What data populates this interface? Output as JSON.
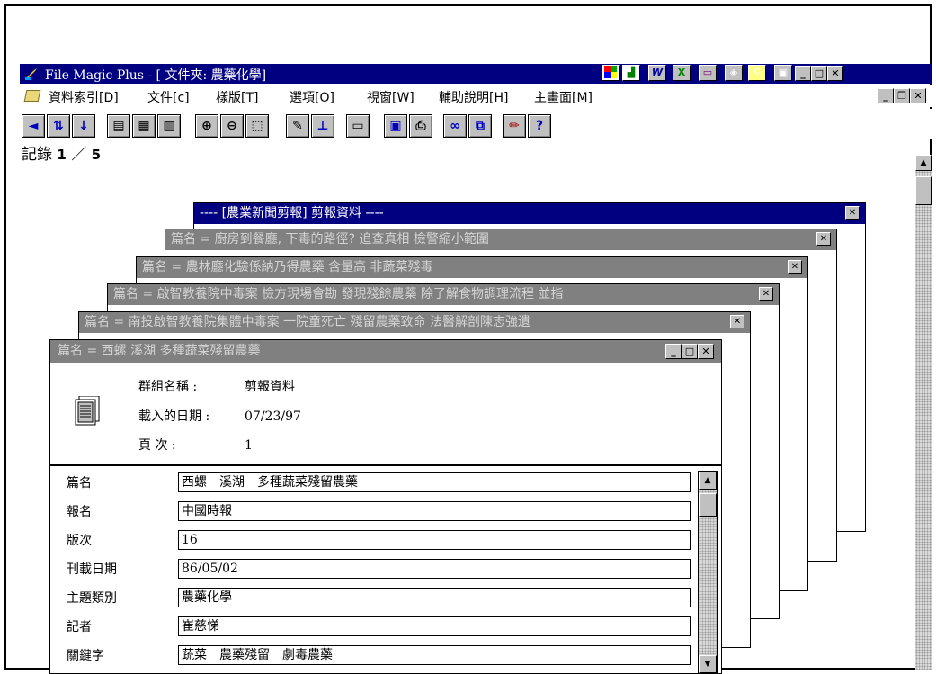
{
  "app": {
    "title": "File Magic Plus - [ 文件夾: 農藥化學]"
  },
  "menu": {
    "items": [
      "資料索引[D]",
      "文件[c]",
      "樣版[T]",
      "選項[O]",
      "視窗[W]",
      "輔助說明[H]",
      "主畫面[M]"
    ]
  },
  "toolbar": {
    "buttons": [
      {
        "icon": "arrow-left-icon",
        "glyph": "◄"
      },
      {
        "icon": "sort-icon",
        "glyph": "⇅"
      },
      {
        "icon": "arrow-down-icon",
        "glyph": "↓"
      },
      {
        "icon": "page-view-icon",
        "glyph": "▤"
      },
      {
        "icon": "form-view-icon",
        "glyph": "▦"
      },
      {
        "icon": "list-view-icon",
        "glyph": "▥"
      },
      {
        "icon": "zoom-in-icon",
        "glyph": "⊕"
      },
      {
        "icon": "zoom-out-icon",
        "glyph": "⊖"
      },
      {
        "icon": "select-area-icon",
        "glyph": "⬚"
      },
      {
        "icon": "edit-icon",
        "glyph": "✎"
      },
      {
        "icon": "pin-icon",
        "glyph": "⊥"
      },
      {
        "icon": "monitor-icon",
        "glyph": "▭"
      },
      {
        "icon": "save-icon",
        "glyph": "▣"
      },
      {
        "icon": "print-icon",
        "glyph": "⎙"
      },
      {
        "icon": "binoculars-icon",
        "glyph": "∞"
      },
      {
        "icon": "search-folder-icon",
        "glyph": "⧉"
      },
      {
        "icon": "pencil-icon",
        "glyph": "✏"
      },
      {
        "icon": "help-icon",
        "glyph": "?"
      }
    ]
  },
  "record": {
    "label": "記錄",
    "current": "1",
    "sep": "／",
    "total": "5"
  },
  "windows": {
    "w1": "---- [農業新聞剪報] 剪報資料 ----",
    "w2": "篇名 = 廚房到餐廳, 下毒的路徑? 追查真相  檢警縮小範圍",
    "w3": "篇名 = 農林廳化驗係納乃得農藥  含量高  非蔬菜殘毒",
    "w4": "篇名 = 啟智教養院中毒案  檢方現場會勘  發現殘餘農藥  除了解食物調理流程  並指",
    "w5": "篇名 = 南投啟智教養院集體中毒案  一院童死亡  殘留農藥致命  法醫解剖陳志強遺",
    "front": "篇名 = 西螺  溪湖  多種蔬菜殘留農藥"
  },
  "info": {
    "group_label": "群組名稱 :",
    "group_value": "剪報資料",
    "date_label": "載入的日期 :",
    "date_value": "07/23/97",
    "page_label": "頁 次   :",
    "page_value": "1"
  },
  "fields": [
    {
      "label": "篇名",
      "value": "西螺　溪湖　多種蔬菜殘留農藥"
    },
    {
      "label": "報名",
      "value": "中國時報"
    },
    {
      "label": "版次",
      "value": "16"
    },
    {
      "label": "刊載日期",
      "value": "86/05/02"
    },
    {
      "label": "主題類別",
      "value": "農藥化學"
    },
    {
      "label": "記者",
      "value": "崔慈悌"
    },
    {
      "label": "關鍵字",
      "value": "蔬菜　農藥殘留　劇毒農藥"
    }
  ]
}
